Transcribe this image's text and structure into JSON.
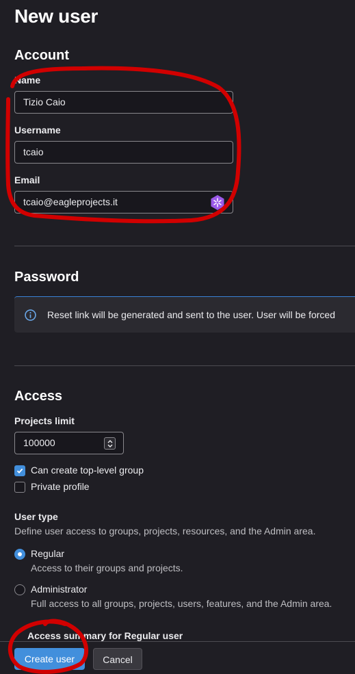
{
  "page": {
    "title": "New user"
  },
  "account": {
    "section_title": "Account",
    "name": {
      "label": "Name",
      "value": "Tizio Caio"
    },
    "username": {
      "label": "Username",
      "value": "tcaio"
    },
    "email": {
      "label": "Email",
      "value": "tcaio@eagleprojects.it"
    }
  },
  "password": {
    "section_title": "Password",
    "notice": "Reset link will be generated and sent to the user. User will be forced"
  },
  "access": {
    "section_title": "Access",
    "projects_limit": {
      "label": "Projects limit",
      "value": "100000"
    },
    "can_create_group": {
      "label": "Can create top-level group",
      "checked": true
    },
    "private_profile": {
      "label": "Private profile",
      "checked": false
    },
    "user_type": {
      "label": "User type",
      "description": "Define user access to groups, projects, resources, and the Admin area.",
      "options": [
        {
          "label": "Regular",
          "help": "Access to their groups and projects.",
          "selected": true
        },
        {
          "label": "Administrator",
          "help": "Full access to all groups, projects, users, features, and the Admin area.",
          "selected": false
        }
      ]
    },
    "summary_title": "Access summary for Regular user"
  },
  "footer": {
    "create_label": "Create user",
    "cancel_label": "Cancel"
  },
  "colors": {
    "background": "#1f1e24",
    "input_background": "#18171d",
    "accent": "#428fdc",
    "annotation": "#d10000",
    "extension_icon": "#9b59e8"
  },
  "icons": {
    "email_extension": "extension-icon",
    "alert": "info-icon",
    "spinner": "chevron-up-down-icon",
    "checkbox": "check-icon"
  }
}
